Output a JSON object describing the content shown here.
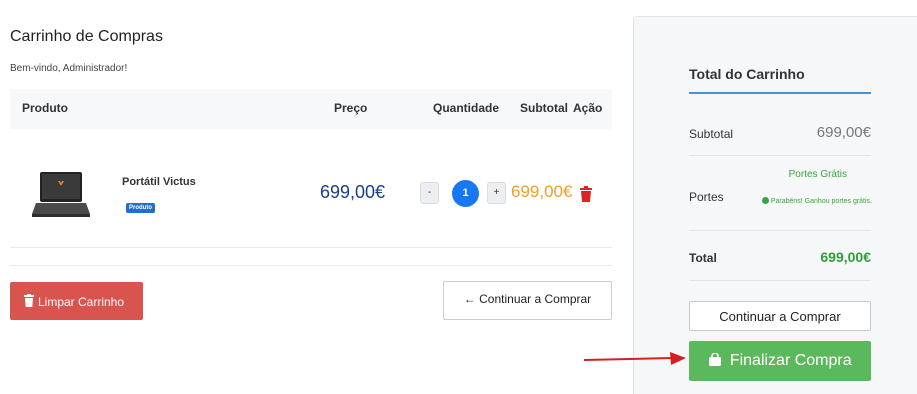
{
  "cart": {
    "title": "Carrinho de Compras",
    "welcome": "Bem-vindo, Administrador!",
    "headers": {
      "product": "Produto",
      "price": "Preço",
      "quantity": "Quantidade",
      "subtotal": "Subtotal",
      "action": "Ação"
    },
    "items": [
      {
        "name": "Portátil Victus",
        "badge": "Produto",
        "price": "699,00€",
        "quantity": "1",
        "minus": "-",
        "plus": "+",
        "subtotal": "699,00€"
      }
    ],
    "clear_button": "Limpar Carrinho",
    "continue_button": "← Continuar a Comprar"
  },
  "summary": {
    "title": "Total do Carrinho",
    "subtotal_label": "Subtotal",
    "subtotal_value": "699,00€",
    "shipping_free": "Portes Grátis",
    "shipping_label": "Portes",
    "shipping_message": "Parabéns! Ganhou portes grátis.",
    "total_label": "Total",
    "total_value": "699,00€",
    "continue_button": "Continuar a Comprar",
    "checkout_button": "Finalizar Compra"
  },
  "icons": {
    "laptop": "laptop-icon",
    "trash": "trash-icon",
    "check": "check-circle-icon",
    "bag": "shopping-bag-icon",
    "arrow": "red-arrow-annotation"
  },
  "colors": {
    "primary_blue": "#1877f2",
    "danger_red": "#d9534f",
    "success_green": "#5cb85c",
    "subtotal_orange": "#f0a020"
  }
}
